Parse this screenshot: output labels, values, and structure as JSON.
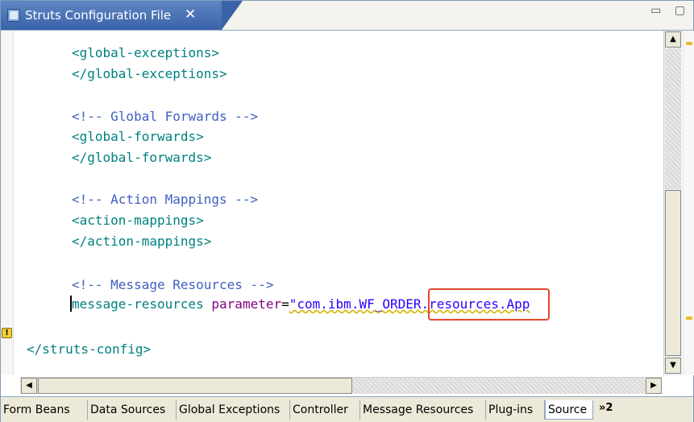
{
  "editor": {
    "tab_title": "Struts Configuration File",
    "close_glyph": "✕",
    "window_controls": "▭ ▢",
    "icons": {
      "tab_icon": "struts-config-file-icon",
      "gutter_marker": "warning-icon"
    },
    "colors": {
      "tag": "#008080",
      "comment": "#3f5fbf",
      "attribute": "#7f007f",
      "string": "#2a00ff",
      "highlight_box": "#e2482c",
      "active_tab": "#3a63a8"
    },
    "warning_glyph": "!"
  },
  "source": {
    "lines": [
      "<global-exceptions>",
      "</global-exceptions>",
      "<!-- Global Forwards -->",
      "<global-forwards>",
      "</global-forwards>",
      "<!-- Action Mappings -->",
      "<action-mappings>",
      "</action-mappings>",
      "<!-- Message Resources -->",
      "message-resources",
      "parameter",
      "=",
      "\"com.ibm.WF_ORDER.resources.App",
      "</struts-config>"
    ]
  },
  "page_tabs": {
    "items": [
      {
        "label": "Form Beans"
      },
      {
        "label": "Data Sources"
      },
      {
        "label": "Global Exceptions"
      },
      {
        "label": "Controller"
      },
      {
        "label": "Message Resources"
      },
      {
        "label": "Plug-ins"
      },
      {
        "label": "Source",
        "active": true
      }
    ],
    "more_label": "»2"
  }
}
